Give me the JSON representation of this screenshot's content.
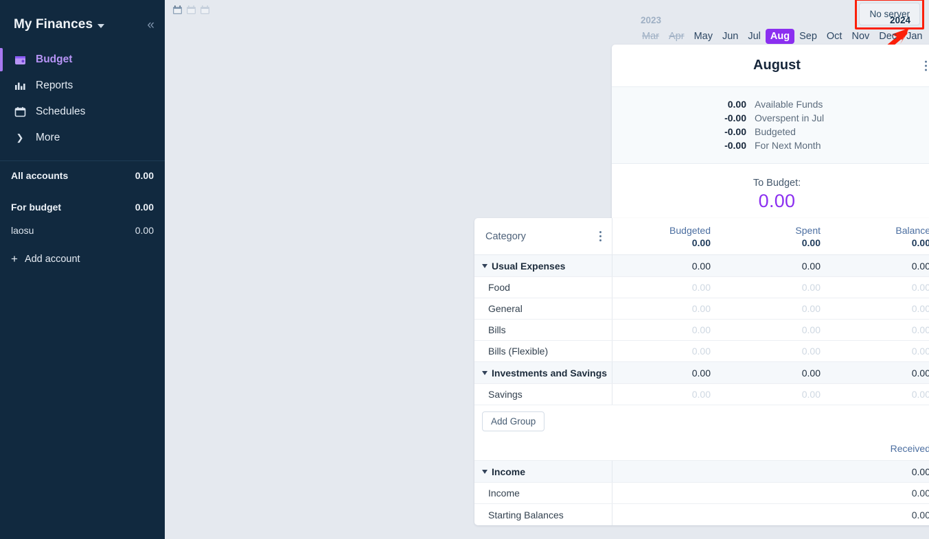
{
  "sidebar": {
    "title": "My Finances",
    "collapse_icon": "chevrons-left-icon",
    "nav": [
      {
        "label": "Budget",
        "icon": "wallet-icon",
        "active": true
      },
      {
        "label": "Reports",
        "icon": "bar-chart-icon",
        "active": false
      },
      {
        "label": "Schedules",
        "icon": "calendar-icon",
        "active": false
      },
      {
        "label": "More",
        "icon": "chevron-right-icon",
        "active": false
      }
    ],
    "accounts": [
      {
        "label": "All accounts",
        "value": "0.00",
        "type": "head"
      },
      {
        "label": "For budget",
        "value": "0.00",
        "type": "head"
      },
      {
        "label": "laosu",
        "value": "0.00",
        "type": "sub"
      }
    ],
    "add_account_label": "Add account"
  },
  "topbar": {
    "view_icons": [
      "calendar-1-month-icon",
      "calendar-3-month-icon",
      "calendar-12-month-icon"
    ],
    "no_server_label": "No server"
  },
  "month_selector": {
    "year_left": "2023",
    "year_right": "2024",
    "months": [
      {
        "label": "Mar",
        "state": "disabled"
      },
      {
        "label": "Apr",
        "state": "disabled"
      },
      {
        "label": "May",
        "state": "normal"
      },
      {
        "label": "Jun",
        "state": "normal"
      },
      {
        "label": "Jul",
        "state": "normal"
      },
      {
        "label": "Aug",
        "state": "selected"
      },
      {
        "label": "Sep",
        "state": "normal"
      },
      {
        "label": "Oct",
        "state": "normal"
      },
      {
        "label": "Nov",
        "state": "normal"
      },
      {
        "label": "Dec",
        "state": "normal"
      },
      {
        "label": "Jan",
        "state": "normal"
      }
    ]
  },
  "summary_card": {
    "title": "August",
    "menu_icon": "kebab-menu-icon",
    "lines": [
      {
        "amount": "0.00",
        "label": "Available Funds"
      },
      {
        "amount": "-0.00",
        "label": "Overspent in Jul"
      },
      {
        "amount": "-0.00",
        "label": "Budgeted"
      },
      {
        "amount": "-0.00",
        "label": "For Next Month"
      }
    ],
    "to_budget_label": "To Budget:",
    "to_budget_value": "0.00"
  },
  "budget_table": {
    "header": {
      "category_label": "Category",
      "menu_icon": "kebab-menu-icon",
      "columns": [
        {
          "label": "Budgeted",
          "value": "0.00"
        },
        {
          "label": "Spent",
          "value": "0.00"
        },
        {
          "label": "Balance",
          "value": "0.00"
        }
      ]
    },
    "rows": [
      {
        "kind": "group",
        "name": "Usual Expenses",
        "values": [
          "0.00",
          "0.00",
          "0.00"
        ]
      },
      {
        "kind": "child",
        "name": "Food",
        "values": [
          "0.00",
          "0.00",
          "0.00"
        ]
      },
      {
        "kind": "child",
        "name": "General",
        "values": [
          "0.00",
          "0.00",
          "0.00"
        ]
      },
      {
        "kind": "child",
        "name": "Bills",
        "values": [
          "0.00",
          "0.00",
          "0.00"
        ]
      },
      {
        "kind": "child",
        "name": "Bills (Flexible)",
        "values": [
          "0.00",
          "0.00",
          "0.00"
        ]
      },
      {
        "kind": "group",
        "name": "Investments and Savings",
        "values": [
          "0.00",
          "0.00",
          "0.00"
        ]
      },
      {
        "kind": "child",
        "name": "Savings",
        "values": [
          "0.00",
          "0.00",
          "0.00"
        ]
      }
    ],
    "add_group_label": "Add Group",
    "received_label": "Received",
    "income_rows": [
      {
        "kind": "group",
        "name": "Income",
        "value": "0.00"
      },
      {
        "kind": "child",
        "name": "Income",
        "value": "0.00"
      },
      {
        "kind": "child",
        "name": "Starting Balances",
        "value": "0.00"
      }
    ]
  },
  "annotation": {
    "color": "#fb1f09",
    "shape": "arrow-pointing-to-no-server-button"
  },
  "colors": {
    "accent": "#8b2ff0",
    "sidebar_bg": "#11293f",
    "page_bg": "#e5e9ef",
    "annotation_red": "#fb1f09"
  }
}
